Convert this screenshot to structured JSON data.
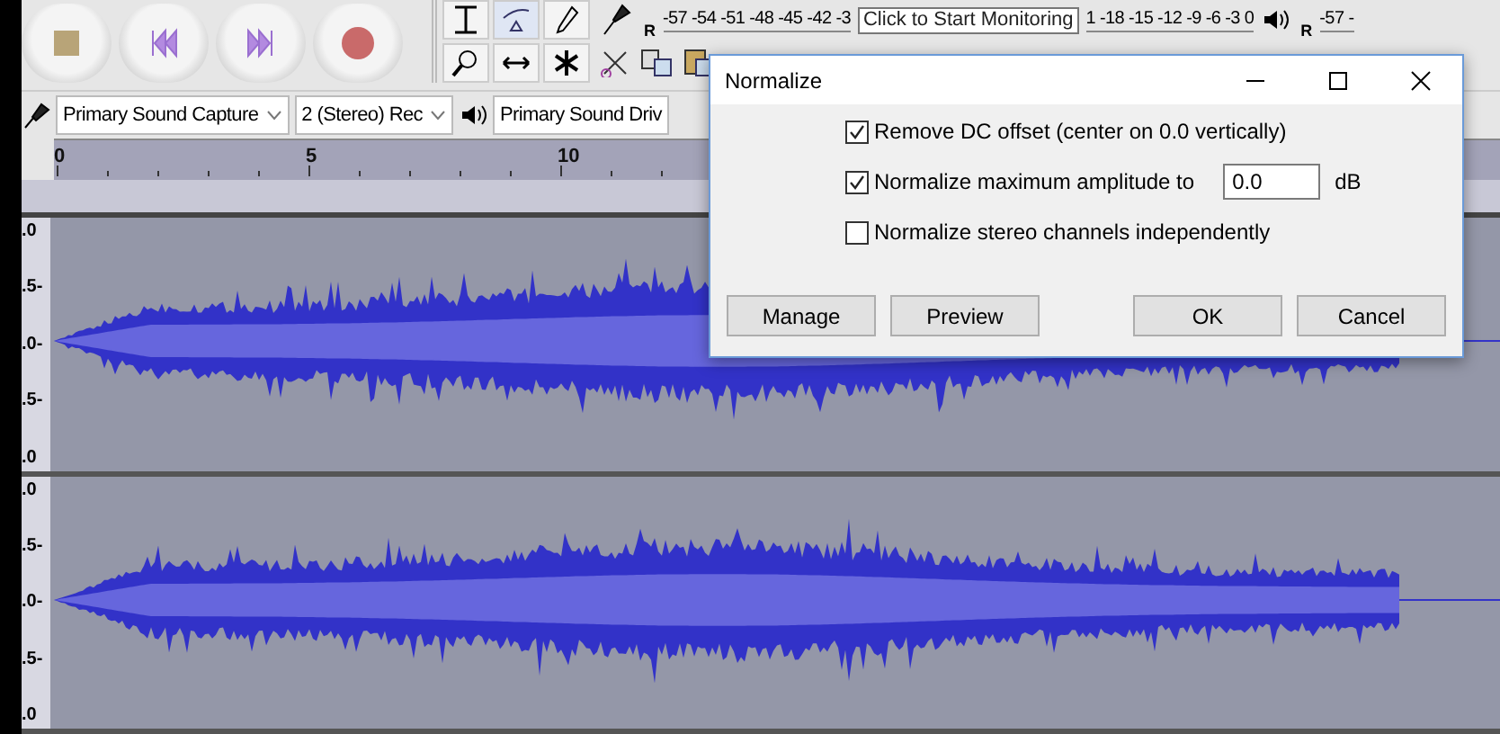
{
  "recording_meter": {
    "channel": "R",
    "scale_start": "-57 -54 -51 -48 -45 -42 -3",
    "scale_end": "1 -18 -15 -12 -9 -6 -3 0"
  },
  "tooltip": "Click to Start Monitoring",
  "playback_meter": {
    "channel": "R",
    "scale": "-57 -"
  },
  "device_toolbar": {
    "recording_device": "Primary Sound Capture",
    "recording_channels": "2 (Stereo) Rec",
    "playback_device": "Primary Sound Driv"
  },
  "ruler": {
    "labels": [
      "0",
      "5",
      "10"
    ]
  },
  "tracks": [
    {
      "scale": [
        ".0",
        ".5-",
        ".0-",
        ".5-",
        ".0"
      ]
    },
    {
      "scale": [
        ".0",
        ".5-",
        ".0-",
        ".5-",
        ".0"
      ]
    }
  ],
  "dialog": {
    "title": "Normalize",
    "options": [
      {
        "kind": "checkbox",
        "label": "Remove DC offset (center on 0.0 vertically)",
        "checked": true
      },
      {
        "kind": "checkbox-field",
        "label": "Normalize maximum amplitude to",
        "checked": true,
        "value": "0.0",
        "unit": "dB"
      },
      {
        "kind": "checkbox",
        "label": "Normalize stereo channels independently",
        "checked": false
      }
    ],
    "left_buttons": [
      "Manage",
      "Preview"
    ],
    "right_buttons": [
      "OK",
      "Cancel"
    ]
  }
}
